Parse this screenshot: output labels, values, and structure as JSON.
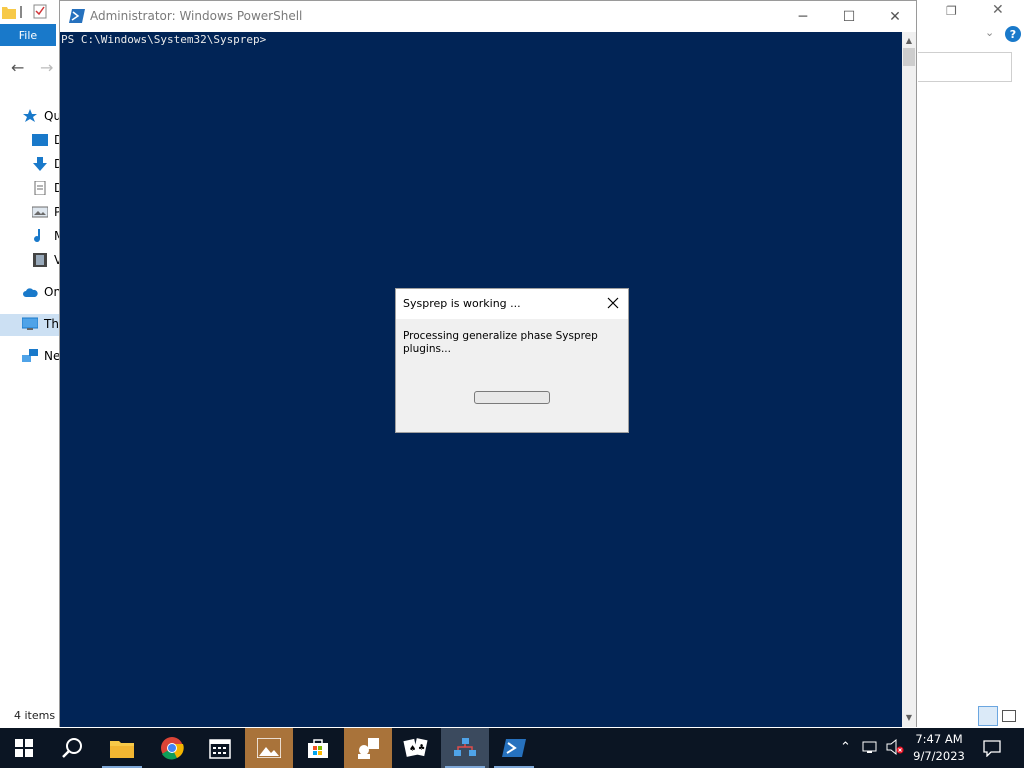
{
  "explorer": {
    "file_tab": "File",
    "nav_items": [
      {
        "label": "Quick access",
        "icon": "star-icon",
        "color": "#1979ca"
      },
      {
        "label": "Desktop",
        "icon": "desktop-icon",
        "color": "#1979ca"
      },
      {
        "label": "Downloads",
        "icon": "download-icon",
        "color": "#1979ca"
      },
      {
        "label": "Documents",
        "icon": "document-icon",
        "color": "#6b6b6b"
      },
      {
        "label": "Pictures",
        "icon": "pictures-icon",
        "color": "#6b6b6b"
      },
      {
        "label": "Music",
        "icon": "music-icon",
        "color": "#1979ca"
      },
      {
        "label": "Videos",
        "icon": "videos-icon",
        "color": "#6b6b6b"
      },
      {
        "label": "OneDrive",
        "icon": "cloud-icon",
        "color": "#1979ca"
      },
      {
        "label": "This PC",
        "icon": "computer-icon",
        "color": "#1979ca"
      },
      {
        "label": "Network",
        "icon": "network-icon",
        "color": "#1979ca"
      }
    ],
    "status": "4 items",
    "help_label": "?"
  },
  "powershell": {
    "title": "Administrator: Windows PowerShell",
    "prompt": "PS C:\\Windows\\System32\\Sysprep>",
    "console_bg": "#012456",
    "minimize_label": "─",
    "maximize_label": "☐",
    "close_label": "✕"
  },
  "dialog": {
    "title": "Sysprep is working ...",
    "message": "Processing generalize phase Sysprep plugins...",
    "progress": 0
  },
  "taskbar": {
    "apps": [
      {
        "name": "start",
        "icon": "windows-icon"
      },
      {
        "name": "search",
        "icon": "search-icon"
      },
      {
        "name": "file-explorer",
        "icon": "folder-icon"
      },
      {
        "name": "chrome",
        "icon": "chrome-icon"
      },
      {
        "name": "calendar",
        "icon": "calendar-icon"
      },
      {
        "name": "photos",
        "icon": "photos-icon"
      },
      {
        "name": "store",
        "icon": "store-icon"
      },
      {
        "name": "people",
        "icon": "people-icon"
      },
      {
        "name": "solitaire",
        "icon": "cards-icon"
      },
      {
        "name": "network-tool",
        "icon": "network-tool-icon"
      },
      {
        "name": "powershell",
        "icon": "powershell-icon"
      }
    ],
    "time": "7:47 AM",
    "date": "9/7/2023"
  }
}
